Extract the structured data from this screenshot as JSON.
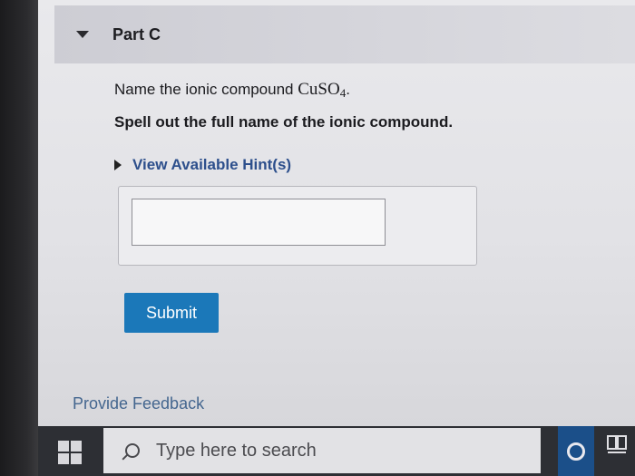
{
  "part": {
    "title": "Part C"
  },
  "question": {
    "prompt": "Name the ionic compound ",
    "formula_main": "CuSO",
    "formula_sub": "4",
    "formula_end": ".",
    "instruction": "Spell out the full name of the ionic compound."
  },
  "hints": {
    "label": "View Available Hint(s)"
  },
  "answer": {
    "value": ""
  },
  "submit": {
    "label": "Submit"
  },
  "feedback": {
    "label": "Provide Feedback"
  },
  "taskbar": {
    "search_placeholder": "Type here to search"
  },
  "colors": {
    "submit_bg": "#1b78b9",
    "link": "#2d4f8c",
    "header_bg": "#d6d6dc"
  },
  "icons": {
    "collapse": "caret-down-icon",
    "hint_toggle": "caret-right-icon",
    "search": "search-icon",
    "start": "windows-logo-icon",
    "cortana": "cortana-icon",
    "task_view": "task-view-icon"
  }
}
